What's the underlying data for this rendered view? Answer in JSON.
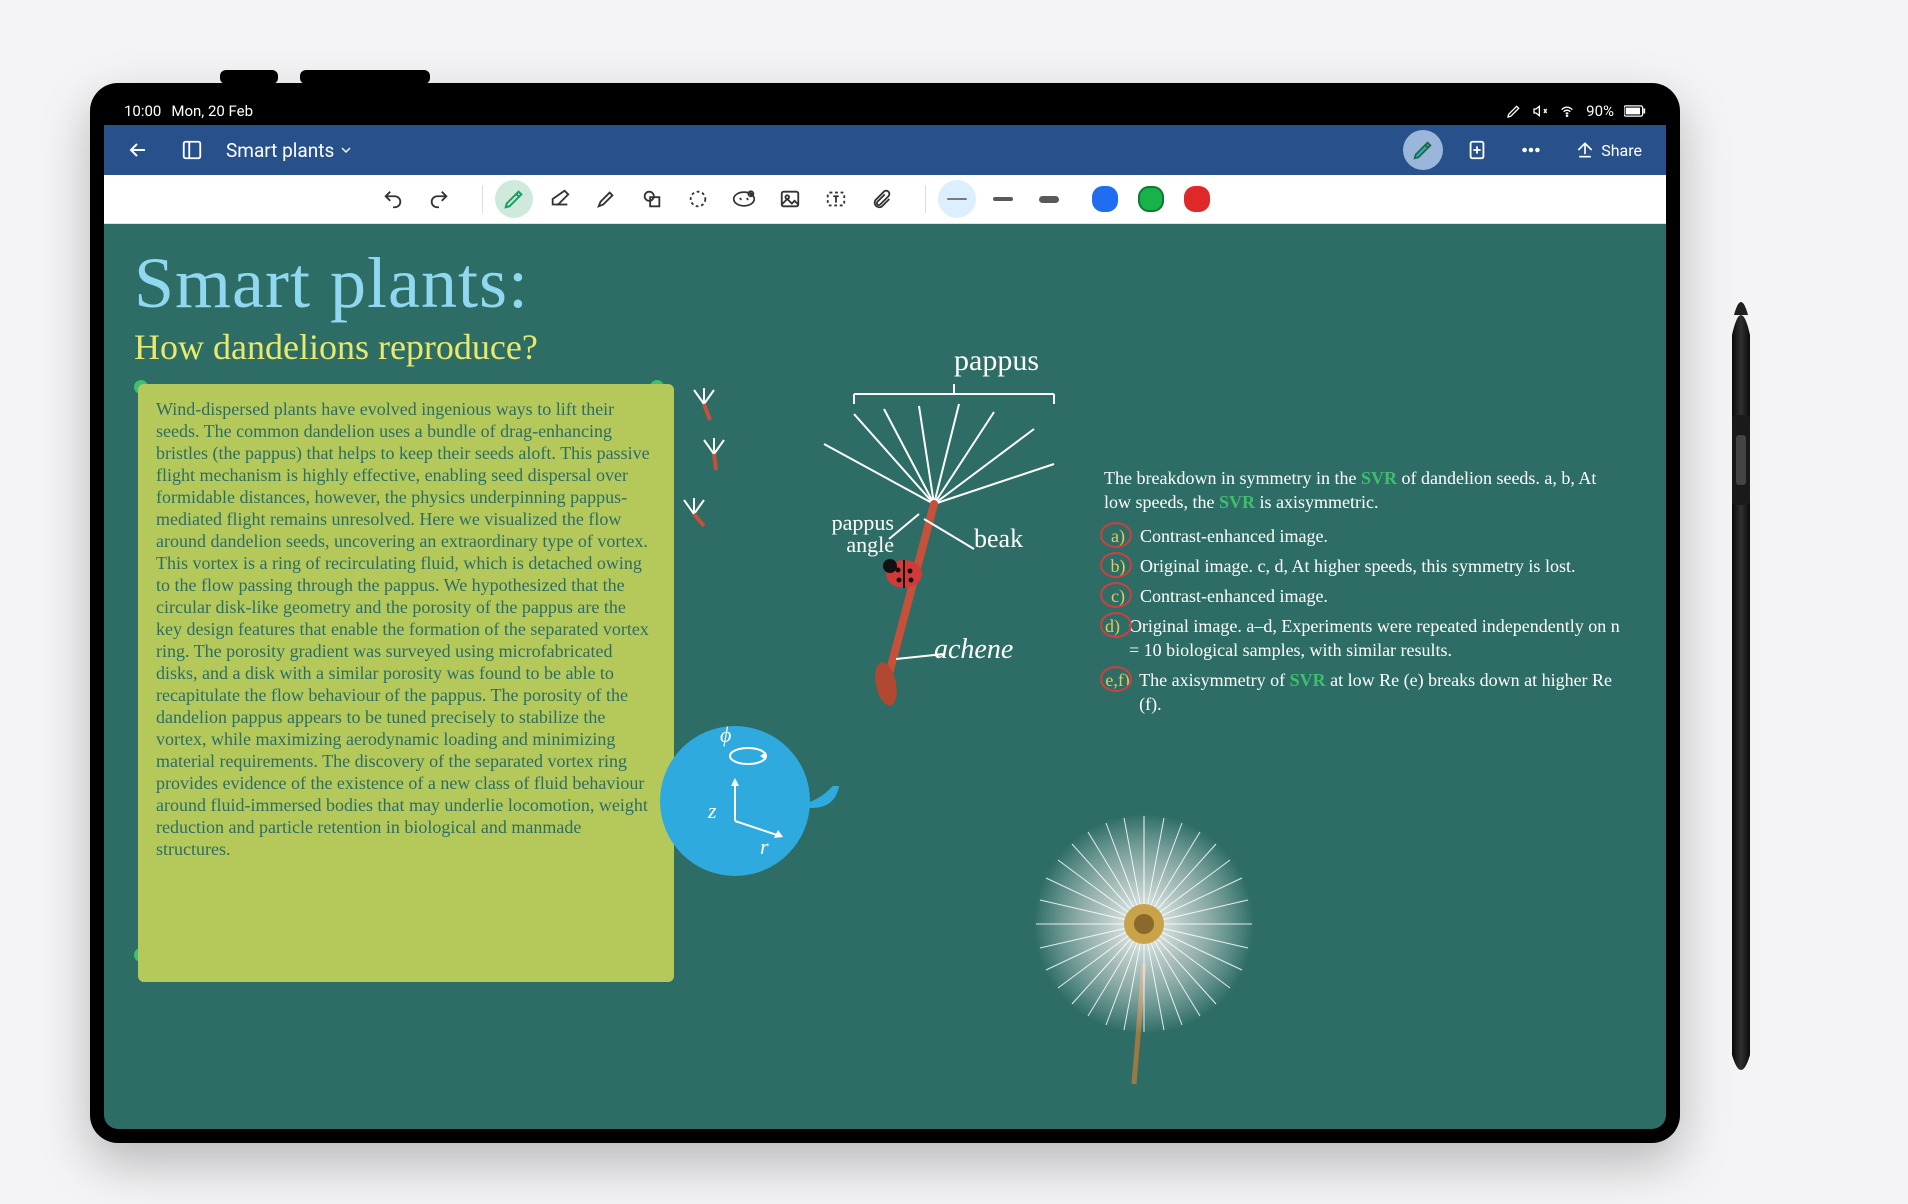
{
  "statusbar": {
    "time": "10:00",
    "date": "Mon, 20 Feb",
    "battery_text": "90%"
  },
  "app": {
    "title": "Smart plants",
    "share_label": "Share"
  },
  "toolbar": {
    "icons": {
      "undo": "undo",
      "redo": "redo",
      "pen": "pen",
      "eraser": "eraser",
      "highlighter": "highlighter",
      "shapes": "shapes",
      "lasso": "lasso",
      "sticker": "sticker",
      "image": "image",
      "textbox": "textbox",
      "attach": "attach"
    },
    "colors": {
      "blue": "#1f6df0",
      "green": "#18b24a",
      "red": "#e02828",
      "grey": "#7a7a7a",
      "black": "#111"
    }
  },
  "canvas": {
    "title": "Smart plants:",
    "subtitle": "How dandelions reproduce?",
    "note_text": "Wind-dispersed plants have evolved ingenious ways to lift their seeds. The common dandelion uses a bundle of drag-enhancing bristles (the pappus) that helps to keep their seeds aloft. This passive flight mechanism is highly effective, enabling seed dispersal over formidable distances, however, the physics underpinning pappus-mediated flight remains unresolved. Here we visualized the flow around dandelion seeds, uncovering an extraordinary type of vortex. This vortex is a ring of recirculating fluid, which is detached owing to the flow passing through the pappus. We hypothesized that the circular disk-like geometry and the porosity of the pappus are the key design features that enable the formation of the separated vortex ring. The porosity gradient was surveyed using microfabricated disks, and a disk with a similar porosity was found to be able to recapitulate the flow behaviour of the pappus. The porosity of the dandelion pappus appears to be tuned precisely to stabilize the vortex, while maximizing aerodynamic loading and minimizing material requirements. The discovery of the separated vortex ring provides evidence of the existence of a new class of fluid behaviour around fluid-immersed bodies that may underlie locomotion, weight reduction and particle retention in biological and manmade structures.",
    "labels": {
      "pappus": "pappus",
      "pappus_angle": "pappus angle",
      "beak": "beak",
      "achene": "achene",
      "phi": "ϕ",
      "z": "z",
      "r": "r"
    },
    "right_intro": "The breakdown in symmetry in the SVR of dandelion seeds. a, b, At low speeds, the SVR is axisymmetric.",
    "right_items": [
      {
        "tag": "a)",
        "text": "Contrast-enhanced image."
      },
      {
        "tag": "b)",
        "text": "Original image. c, d, At higher speeds, this symmetry is lost."
      },
      {
        "tag": "c)",
        "text": "Contrast-enhanced image."
      },
      {
        "tag": "d)",
        "text": "Original image. a–d, Experiments were repeated independently on n = 10 biological samples, with similar results."
      },
      {
        "tag": "e,f)",
        "text": "The axisymmetry of SVR at low Re (e) breaks down at higher Re (f)."
      }
    ]
  }
}
